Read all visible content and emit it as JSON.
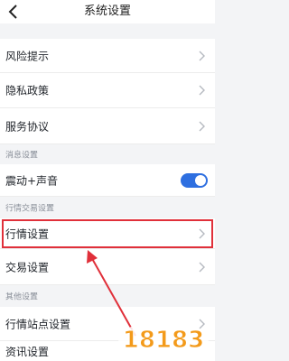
{
  "header": {
    "title": "系统设置"
  },
  "rows": {
    "risk": {
      "label": "风险提示"
    },
    "privacy": {
      "label": "隐私政策"
    },
    "service": {
      "label": "服务协议"
    },
    "vibrate": {
      "label": "震动+声音",
      "toggle_on": true
    },
    "quote": {
      "label": "行情设置"
    },
    "trade": {
      "label": "交易设置"
    },
    "station": {
      "label": "行情站点设置"
    },
    "news": {
      "label": "资讯设置"
    }
  },
  "sections": {
    "message": "消息设置",
    "quote_trade": "行情交易设置",
    "other": "其他设置"
  },
  "colors": {
    "toggle_accent": "#2e6fe0",
    "highlight": "#e0303a",
    "watermark_orange": "#f39a1a",
    "watermark_pink": "#e8467c"
  },
  "watermark": {
    "text": "18183"
  }
}
